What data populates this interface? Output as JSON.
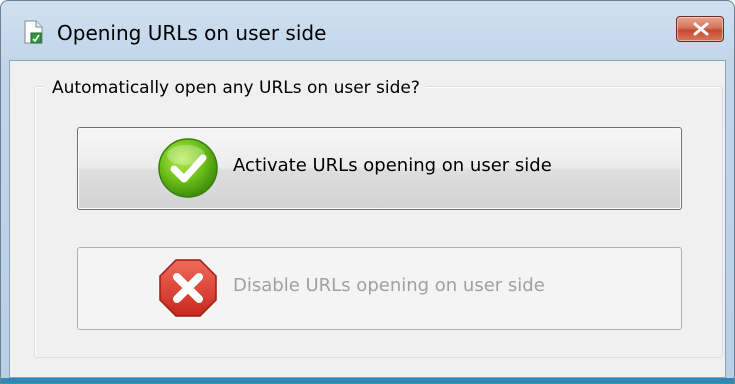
{
  "window": {
    "title": "Opening URLs on user side"
  },
  "icons": {
    "title": "document-icon",
    "close": "close-icon",
    "activate": "green-check-icon",
    "disable": "red-x-icon"
  },
  "group": {
    "label": "Automatically open any URLs on user side?"
  },
  "buttons": {
    "activate_label": "Activate URLs opening on user side",
    "disable_label": "Disable URLs opening on user side"
  },
  "colors": {
    "close_button": "#c24a31",
    "check_green": "#5fb514",
    "x_red": "#d8392b",
    "disabled_text": "#a0a0a0"
  }
}
